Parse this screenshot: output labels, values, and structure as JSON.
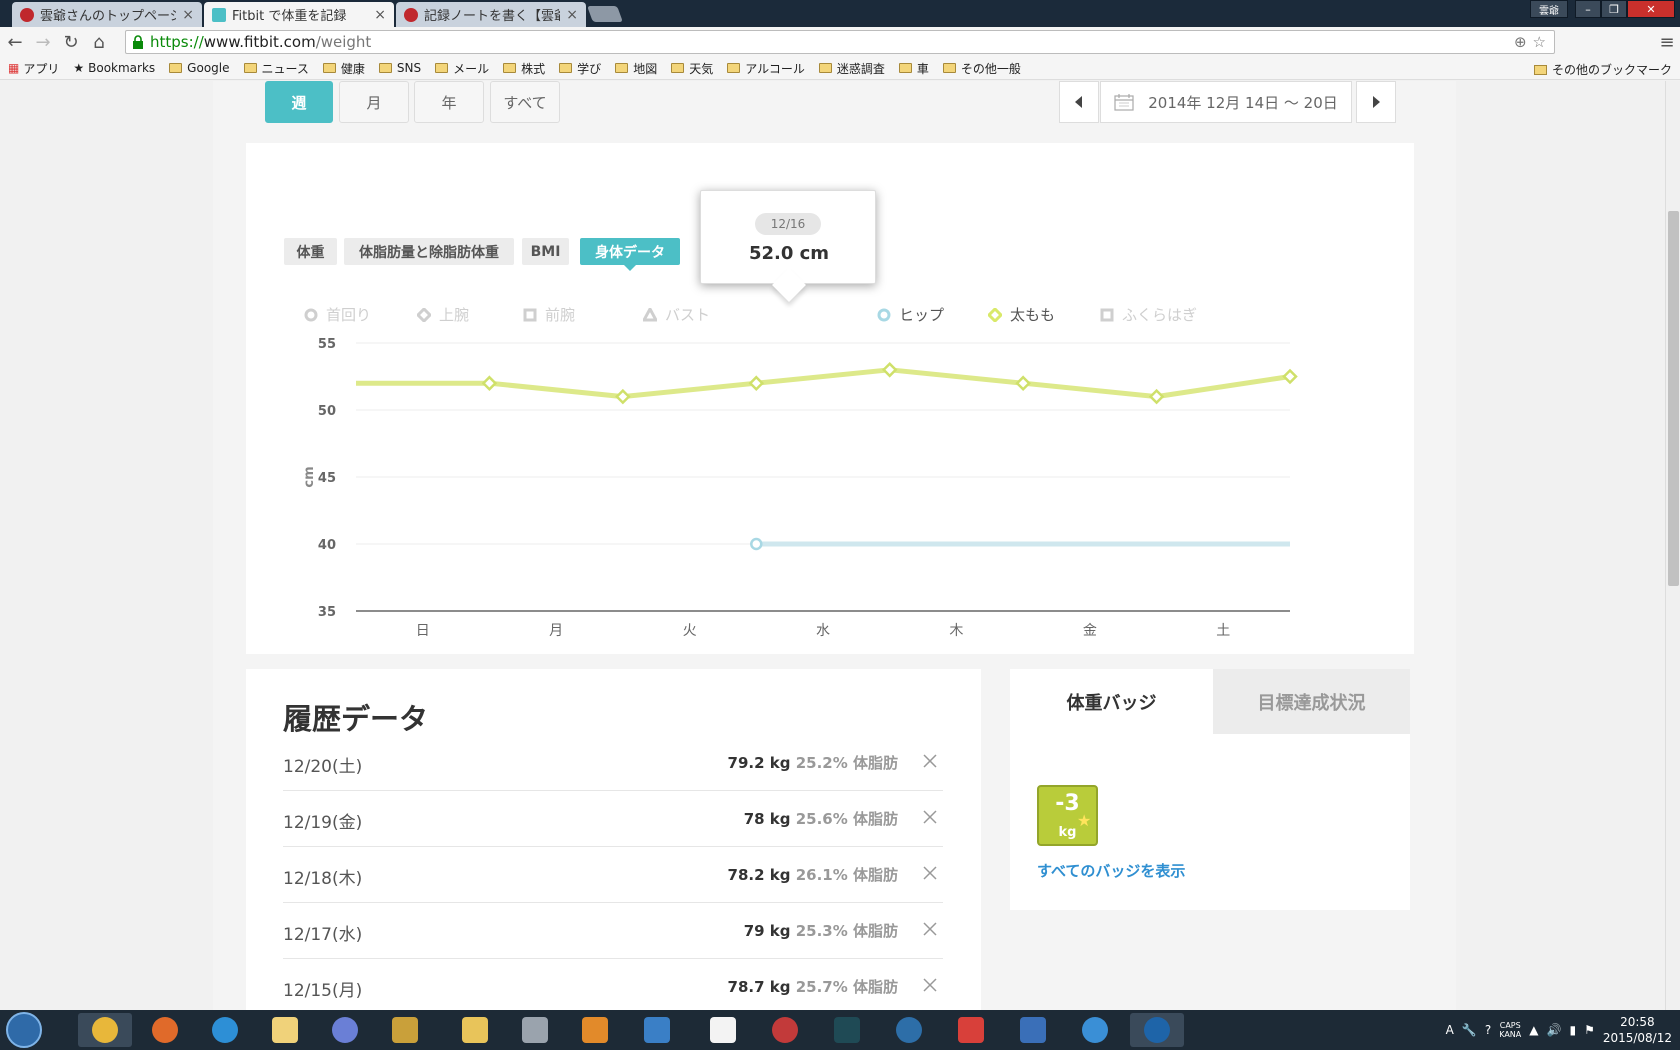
{
  "browser": {
    "tabs": [
      {
        "title": "雲爺さんのトップページ"
      },
      {
        "title": "Fitbit で体重を記録"
      },
      {
        "title": "記録ノートを書く【雲爺】"
      }
    ],
    "window_user": "雲爺",
    "url": {
      "scheme": "https://",
      "host": "www.fitbit.com",
      "path": "/weight"
    },
    "bookmarks": [
      "アプリ",
      "Bookmarks",
      "Google",
      "ニュース",
      "健康",
      "SNS",
      "メール",
      "株式",
      "学び",
      "地図",
      "天気",
      "アルコール",
      "迷惑調査",
      "車",
      "その他一般"
    ],
    "other_bookmarks": "その他のブックマーク"
  },
  "range": {
    "week": "週",
    "month": "月",
    "year": "年",
    "all": "すべて",
    "selected": "週",
    "date_range": "2014年 12月 14日 ～ 20日"
  },
  "subtabs": {
    "weight": "体重",
    "fat": "体脂肪量と除脂肪体重",
    "bmi": "BMI",
    "body": "身体データ"
  },
  "legend": [
    {
      "label": "首回り",
      "shape": "circle",
      "color": "#cfcfcf"
    },
    {
      "label": "上腕",
      "shape": "diamond",
      "color": "#cfcfcf"
    },
    {
      "label": "前腕",
      "shape": "square",
      "color": "#cfcfcf"
    },
    {
      "label": "バスト",
      "shape": "triangle",
      "color": "#cfcfcf"
    },
    {
      "label": "ヒップ",
      "shape": "circle",
      "color": "#a8d8e4"
    },
    {
      "label": "太もも",
      "shape": "diamond",
      "color": "#d9e96a"
    },
    {
      "label": "ふくらはぎ",
      "shape": "square",
      "color": "#cfcfcf"
    }
  ],
  "tooltip": {
    "date": "12/16",
    "value": "52.0 cm"
  },
  "chart_data": {
    "type": "line",
    "ylabel": "cm",
    "ylim": [
      35,
      55
    ],
    "yticks": [
      55,
      50,
      45,
      40,
      35
    ],
    "categories": [
      "日",
      "月",
      "火",
      "水",
      "木",
      "金",
      "土"
    ],
    "x": [
      0,
      1,
      2,
      3,
      4,
      5,
      6,
      7
    ],
    "series": [
      {
        "name": "太もも",
        "color": "#dde98a",
        "marker": "diamond",
        "values": [
          52.0,
          52.0,
          51.0,
          52.0,
          53.0,
          52.0,
          51.0,
          52.5
        ]
      },
      {
        "name": "ヒップ",
        "color": "#cfe7ee",
        "marker": "circle",
        "values": [
          null,
          null,
          null,
          40.0,
          40.0,
          40.0,
          40.0,
          40.0
        ]
      }
    ]
  },
  "history": {
    "title": "履歴データ",
    "rows": [
      {
        "date": "12/20(土)",
        "weight": "79.2 kg",
        "fat": "25.2% 体脂肪"
      },
      {
        "date": "12/19(金)",
        "weight": "78 kg",
        "fat": "25.6% 体脂肪"
      },
      {
        "date": "12/18(木)",
        "weight": "78.2 kg",
        "fat": "26.1% 体脂肪"
      },
      {
        "date": "12/17(水)",
        "weight": "79 kg",
        "fat": "25.3% 体脂肪"
      },
      {
        "date": "12/15(月)",
        "weight": "78.7 kg",
        "fat": "25.7% 体脂肪"
      }
    ]
  },
  "badges": {
    "tab_badges": "体重バッジ",
    "tab_goals": "目標達成状況",
    "badge_number": "-3",
    "badge_unit": "kg",
    "link": "すべてのバッジを表示"
  },
  "taskbar": {
    "time": "20:58",
    "date": "2015/08/12",
    "caps": "CAPS",
    "kana": "KANA"
  },
  "colors": {
    "accent": "#4cbfc6",
    "link": "#2f8fd1"
  }
}
